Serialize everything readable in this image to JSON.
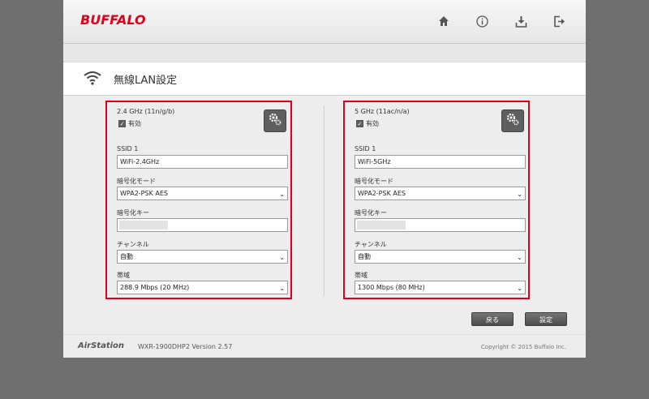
{
  "brand": {
    "logo": "BUFFALO"
  },
  "header_icons": [
    "home-icon",
    "info-icon",
    "download-icon",
    "logout-icon"
  ],
  "page": {
    "title": "無線LAN設定"
  },
  "panels": [
    {
      "band": "2.4 GHz (11n/g/b)",
      "enable_label": "有効",
      "enabled": true,
      "ssid_label": "SSID 1",
      "ssid_value": "WiFi-2.4GHz",
      "enc_mode_label": "暗号化モード",
      "enc_mode_value": "WPA2-PSK AES",
      "enc_key_label": "暗号化キー",
      "channel_label": "チャンネル",
      "channel_value": "自動",
      "bandwidth_label": "帯域",
      "bandwidth_value": "288.9 Mbps (20 MHz)"
    },
    {
      "band": "5 GHz (11ac/n/a)",
      "enable_label": "有効",
      "enabled": true,
      "ssid_label": "SSID 1",
      "ssid_value": "WiFi-5GHz",
      "enc_mode_label": "暗号化モード",
      "enc_mode_value": "WPA2-PSK AES",
      "enc_key_label": "暗号化キー",
      "channel_label": "チャンネル",
      "channel_value": "自動",
      "bandwidth_label": "帯域",
      "bandwidth_value": "1300 Mbps (80 MHz)"
    }
  ],
  "buttons": {
    "back": "戻る",
    "apply": "設定"
  },
  "footer": {
    "product": "AirStation",
    "model": "WXR-1900DHP2   Version 2.57",
    "copyright": "Copyright © 2015 Buffalo Inc."
  },
  "colors": {
    "accent": "#e2001a",
    "button": "#5f5f5f"
  }
}
